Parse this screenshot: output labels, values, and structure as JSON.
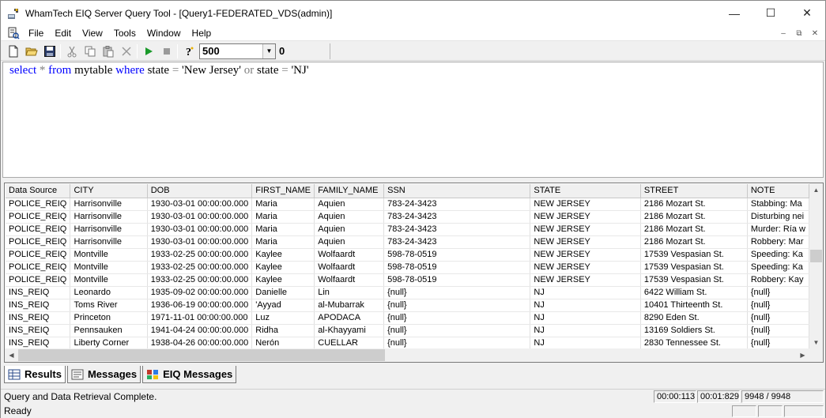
{
  "window": {
    "title": "WhamTech EIQ Server Query Tool - [Query1-FEDERATED_VDS(admin)]",
    "controls": {
      "minimize": "—",
      "maximize": "☐",
      "close": "✕"
    }
  },
  "menu": {
    "items": [
      "File",
      "Edit",
      "View",
      "Tools",
      "Window",
      "Help"
    ],
    "mdi_controls": {
      "minimize": "–",
      "restore": "⧉",
      "close": "✕"
    }
  },
  "toolbar": {
    "row_limit": "500",
    "row_count": "0"
  },
  "query": {
    "tokens": [
      {
        "t": "select",
        "c": "kw"
      },
      {
        "t": " ",
        "c": "id"
      },
      {
        "t": "*",
        "c": "op"
      },
      {
        "t": " ",
        "c": "id"
      },
      {
        "t": "from",
        "c": "kw"
      },
      {
        "t": " mytable ",
        "c": "id"
      },
      {
        "t": "where",
        "c": "kw"
      },
      {
        "t": " state ",
        "c": "id"
      },
      {
        "t": "=",
        "c": "op"
      },
      {
        "t": " 'New Jersey' ",
        "c": "str"
      },
      {
        "t": "or",
        "c": "op"
      },
      {
        "t": " state ",
        "c": "id"
      },
      {
        "t": "=",
        "c": "op"
      },
      {
        "t": " 'NJ'",
        "c": "str"
      }
    ]
  },
  "grid": {
    "columns": [
      "Data Source",
      "CITY",
      "DOB",
      "FIRST_NAME",
      "FAMILY_NAME",
      "SSN",
      "STATE",
      "STREET",
      "NOTE"
    ],
    "rows": [
      [
        "POLICE_REIQ",
        "Harrisonville",
        "1930-03-01 00:00:00.000",
        "Maria",
        "Aquien",
        "783-24-3423",
        "NEW JERSEY",
        "2186 Mozart St.",
        "Stabbing: Ma"
      ],
      [
        "POLICE_REIQ",
        "Harrisonville",
        "1930-03-01 00:00:00.000",
        "Maria",
        "Aquien",
        "783-24-3423",
        "NEW JERSEY",
        "2186 Mozart St.",
        "Disturbing nei"
      ],
      [
        "POLICE_REIQ",
        "Harrisonville",
        "1930-03-01 00:00:00.000",
        "Maria",
        "Aquien",
        "783-24-3423",
        "NEW JERSEY",
        "2186 Mozart St.",
        "Murder: Ría w"
      ],
      [
        "POLICE_REIQ",
        "Harrisonville",
        "1930-03-01 00:00:00.000",
        "Maria",
        "Aquien",
        "783-24-3423",
        "NEW JERSEY",
        "2186 Mozart St.",
        "Robbery: Mar"
      ],
      [
        "POLICE_REIQ",
        "Montville",
        "1933-02-25 00:00:00.000",
        "Kaylee",
        "Wolfaardt",
        "598-78-0519",
        "NEW JERSEY",
        "17539 Vespasian St.",
        "Speeding: Ka"
      ],
      [
        "POLICE_REIQ",
        "Montville",
        "1933-02-25 00:00:00.000",
        "Kaylee",
        "Wolfaardt",
        "598-78-0519",
        "NEW JERSEY",
        "17539 Vespasian St.",
        "Speeding: Ka"
      ],
      [
        "POLICE_REIQ",
        "Montville",
        "1933-02-25 00:00:00.000",
        "Kaylee",
        "Wolfaardt",
        "598-78-0519",
        "NEW JERSEY",
        "17539 Vespasian St.",
        "Robbery: Kay"
      ],
      [
        "INS_REIQ",
        "Leonardo",
        "1935-09-02 00:00:00.000",
        "Danielle",
        "Lin",
        "{null}",
        "NJ",
        "6422 William St.",
        "{null}"
      ],
      [
        "INS_REIQ",
        "Toms River",
        "1936-06-19 00:00:00.000",
        "'Ayyad",
        "al-Mubarrak",
        "{null}",
        "NJ",
        "10401 Thirteenth St.",
        "{null}"
      ],
      [
        "INS_REIQ",
        "Princeton",
        "1971-11-01 00:00:00.000",
        "Luz",
        "APODACA",
        "{null}",
        "NJ",
        "8290 Eden St.",
        "{null}"
      ],
      [
        "INS_REIQ",
        "Pennsauken",
        "1941-04-24 00:00:00.000",
        "Ridha",
        "al-Khayyami",
        "{null}",
        "NJ",
        "13169 Soldiers St.",
        "{null}"
      ],
      [
        "INS_REIQ",
        "Liberty Corner",
        "1938-04-26 00:00:00.000",
        "Nerón",
        "CUELLAR",
        "{null}",
        "NJ",
        "2830 Tennessee St.",
        "{null}"
      ]
    ]
  },
  "tabs": [
    {
      "label": "Results",
      "icon": "results-grid-icon",
      "active": true
    },
    {
      "label": "Messages",
      "icon": "messages-icon",
      "active": false
    },
    {
      "label": "EIQ Messages",
      "icon": "eiq-messages-icon",
      "active": false
    }
  ],
  "status": {
    "message": "Query and Data Retrieval Complete.",
    "time1": "00:00:113",
    "time2": "00:01:829",
    "records": "9948 / 9948",
    "ready": "Ready"
  }
}
